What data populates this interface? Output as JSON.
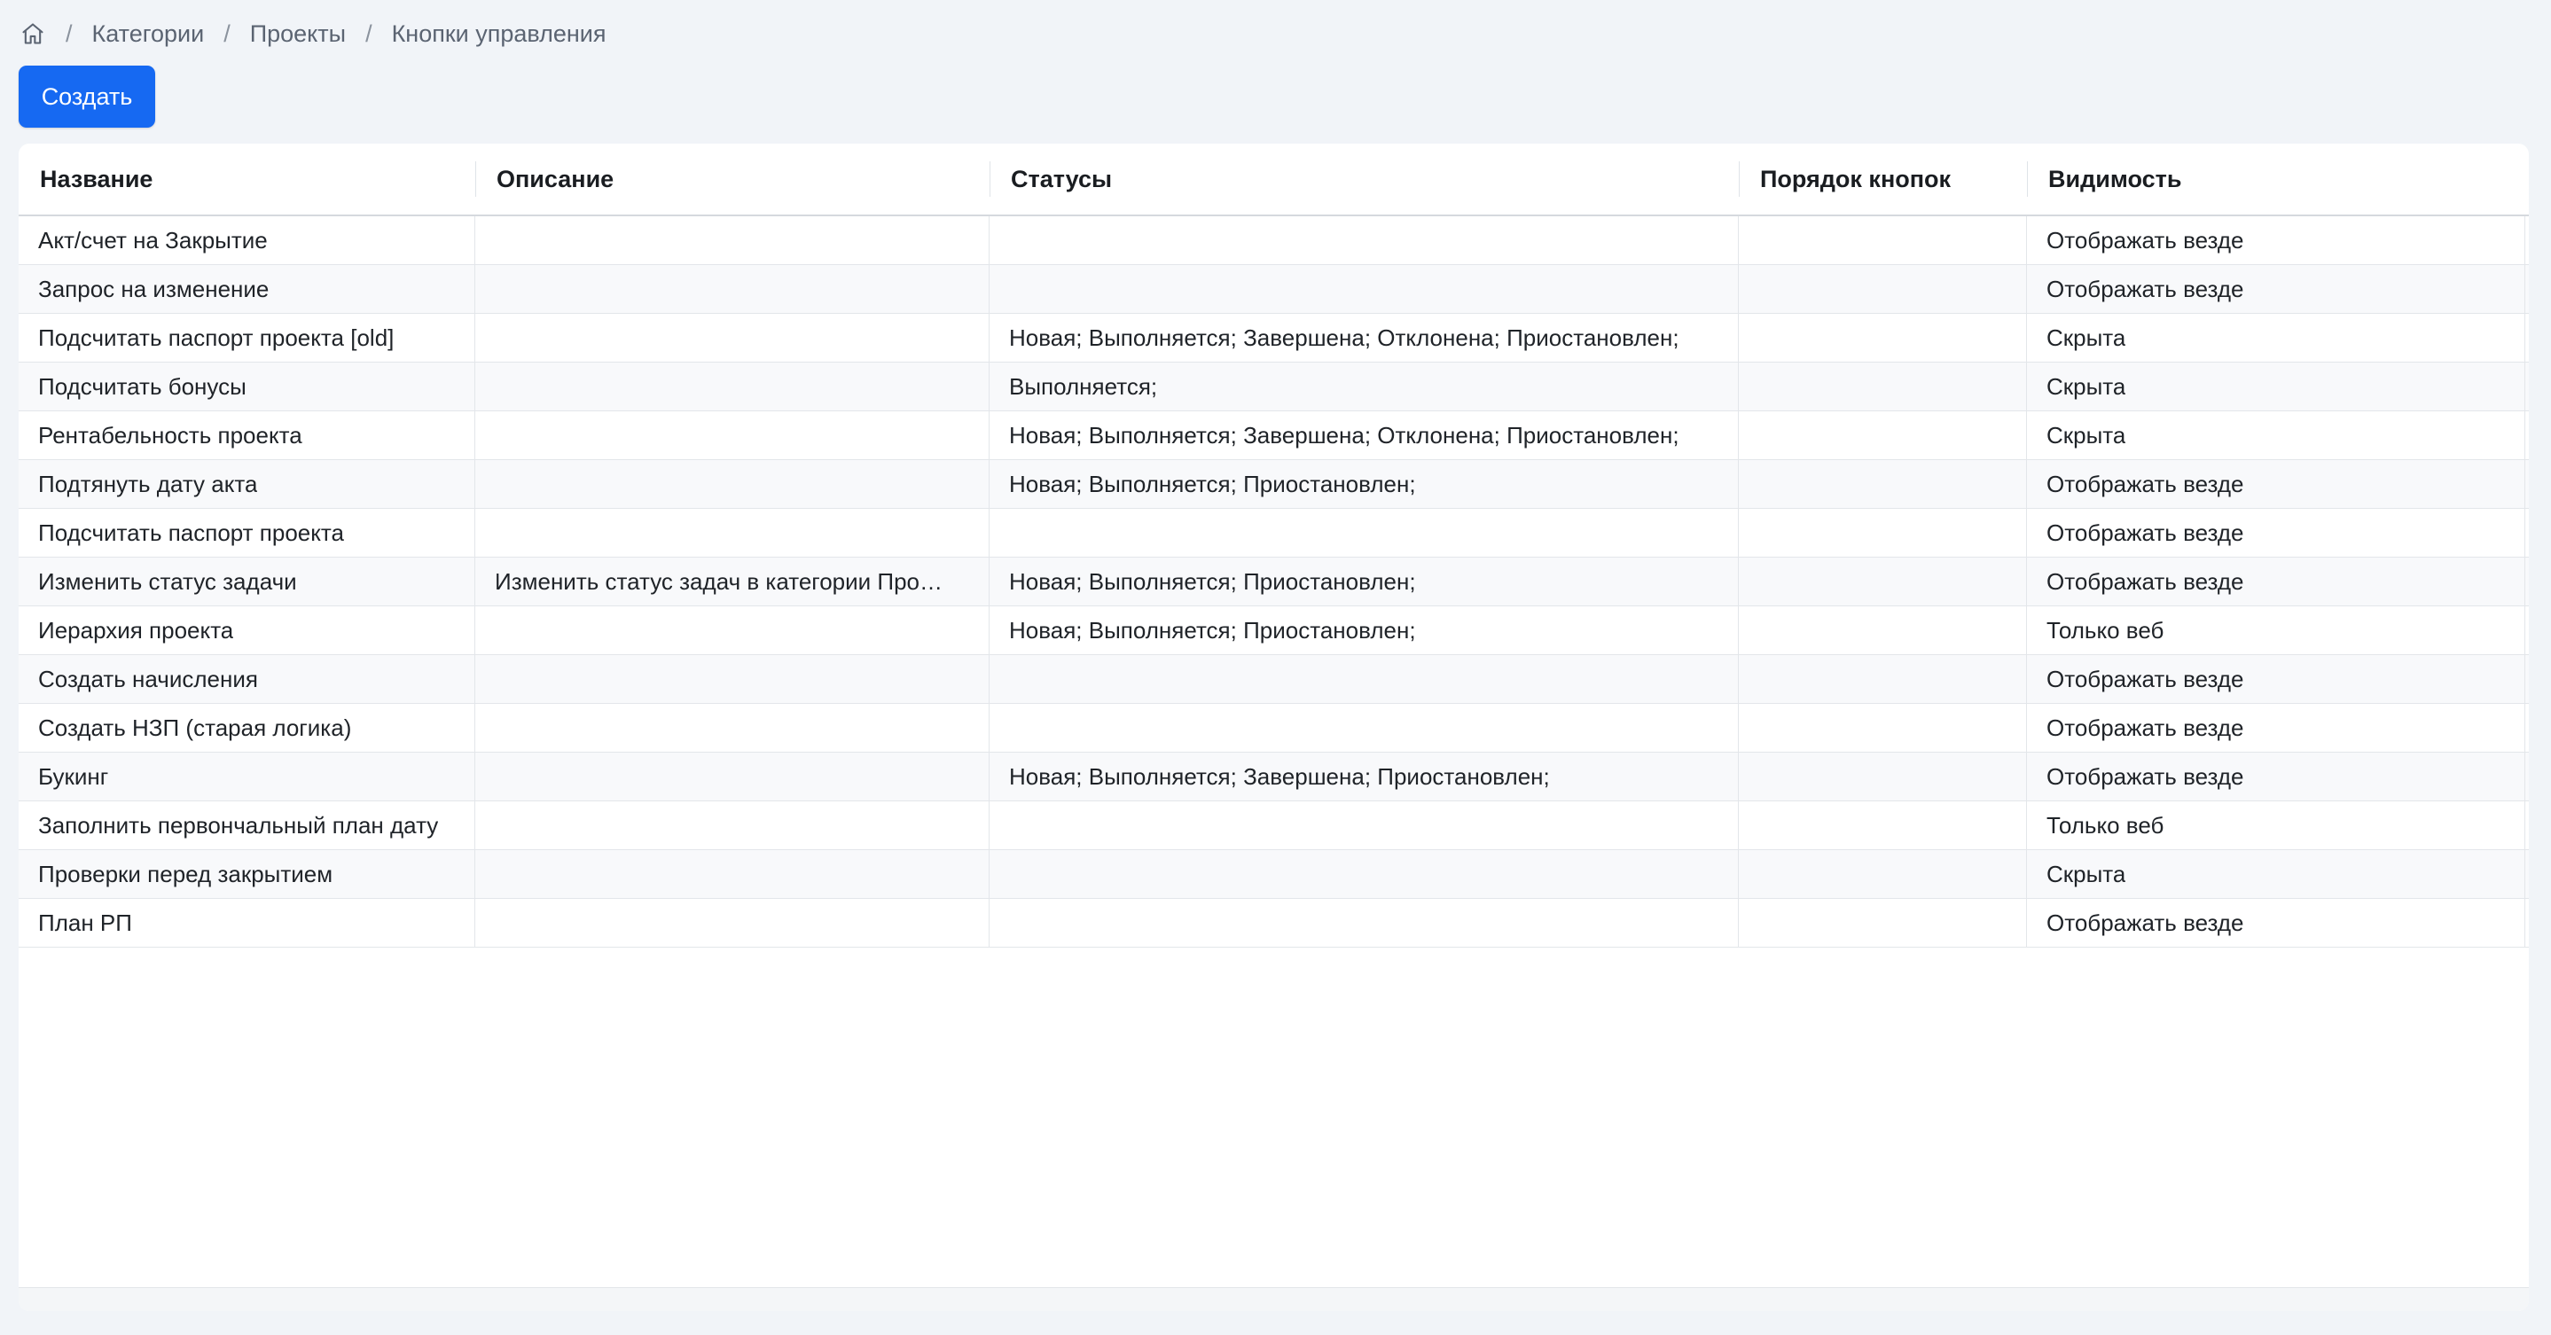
{
  "breadcrumb": {
    "icon": "home-icon",
    "items": [
      "Категории",
      "Проекты",
      "Кнопки управления"
    ],
    "separator": "/"
  },
  "toolbar": {
    "create_label": "Создать",
    "create_color": "#1669f2"
  },
  "table": {
    "columns": [
      "Название",
      "Описание",
      "Статусы",
      "Порядок кнопок",
      "Видимость"
    ],
    "rows": [
      {
        "name": "Акт/счет на Закрытие",
        "description": "",
        "statuses": "",
        "order": "",
        "visibility": "Отображать везде"
      },
      {
        "name": "Запрос на изменение",
        "description": "",
        "statuses": "",
        "order": "",
        "visibility": "Отображать везде"
      },
      {
        "name": "Подсчитать паспорт проекта [old]",
        "description": "",
        "statuses": "Новая; Выполняется; Завершена; Отклонена; Приостановлен;",
        "order": "",
        "visibility": "Скрыта"
      },
      {
        "name": "Подсчитать бонусы",
        "description": "",
        "statuses": "Выполняется;",
        "order": "",
        "visibility": "Скрыта"
      },
      {
        "name": "Рентабельность проекта",
        "description": "",
        "statuses": "Новая; Выполняется; Завершена; Отклонена; Приостановлен;",
        "order": "",
        "visibility": "Скрыта"
      },
      {
        "name": "Подтянуть дату акта",
        "description": "",
        "statuses": "Новая; Выполняется; Приостановлен;",
        "order": "",
        "visibility": "Отображать везде"
      },
      {
        "name": "Подсчитать паспорт проекта",
        "description": "",
        "statuses": "",
        "order": "",
        "visibility": "Отображать везде"
      },
      {
        "name": "Изменить статус задачи",
        "description": "Изменить статус задач в категории Про…",
        "statuses": "Новая; Выполняется; Приостановлен;",
        "order": "",
        "visibility": "Отображать везде"
      },
      {
        "name": "Иерархия проекта",
        "description": "",
        "statuses": "Новая; Выполняется; Приостановлен;",
        "order": "",
        "visibility": "Только веб"
      },
      {
        "name": "Создать начисления",
        "description": "",
        "statuses": "",
        "order": "",
        "visibility": "Отображать везде"
      },
      {
        "name": "Создать НЗП (старая логика)",
        "description": "",
        "statuses": "",
        "order": "",
        "visibility": "Отображать везде"
      },
      {
        "name": "Букинг",
        "description": "",
        "statuses": "Новая; Выполняется; Завершена; Приостановлен;",
        "order": "",
        "visibility": "Отображать везде"
      },
      {
        "name": "Заполнить первончальный план дату",
        "description": "",
        "statuses": "",
        "order": "",
        "visibility": "Только веб"
      },
      {
        "name": "Проверки перед закрытием",
        "description": "",
        "statuses": "",
        "order": "",
        "visibility": "Скрыта"
      },
      {
        "name": "План РП",
        "description": "",
        "statuses": "",
        "order": "",
        "visibility": "Отображать везде"
      }
    ]
  }
}
